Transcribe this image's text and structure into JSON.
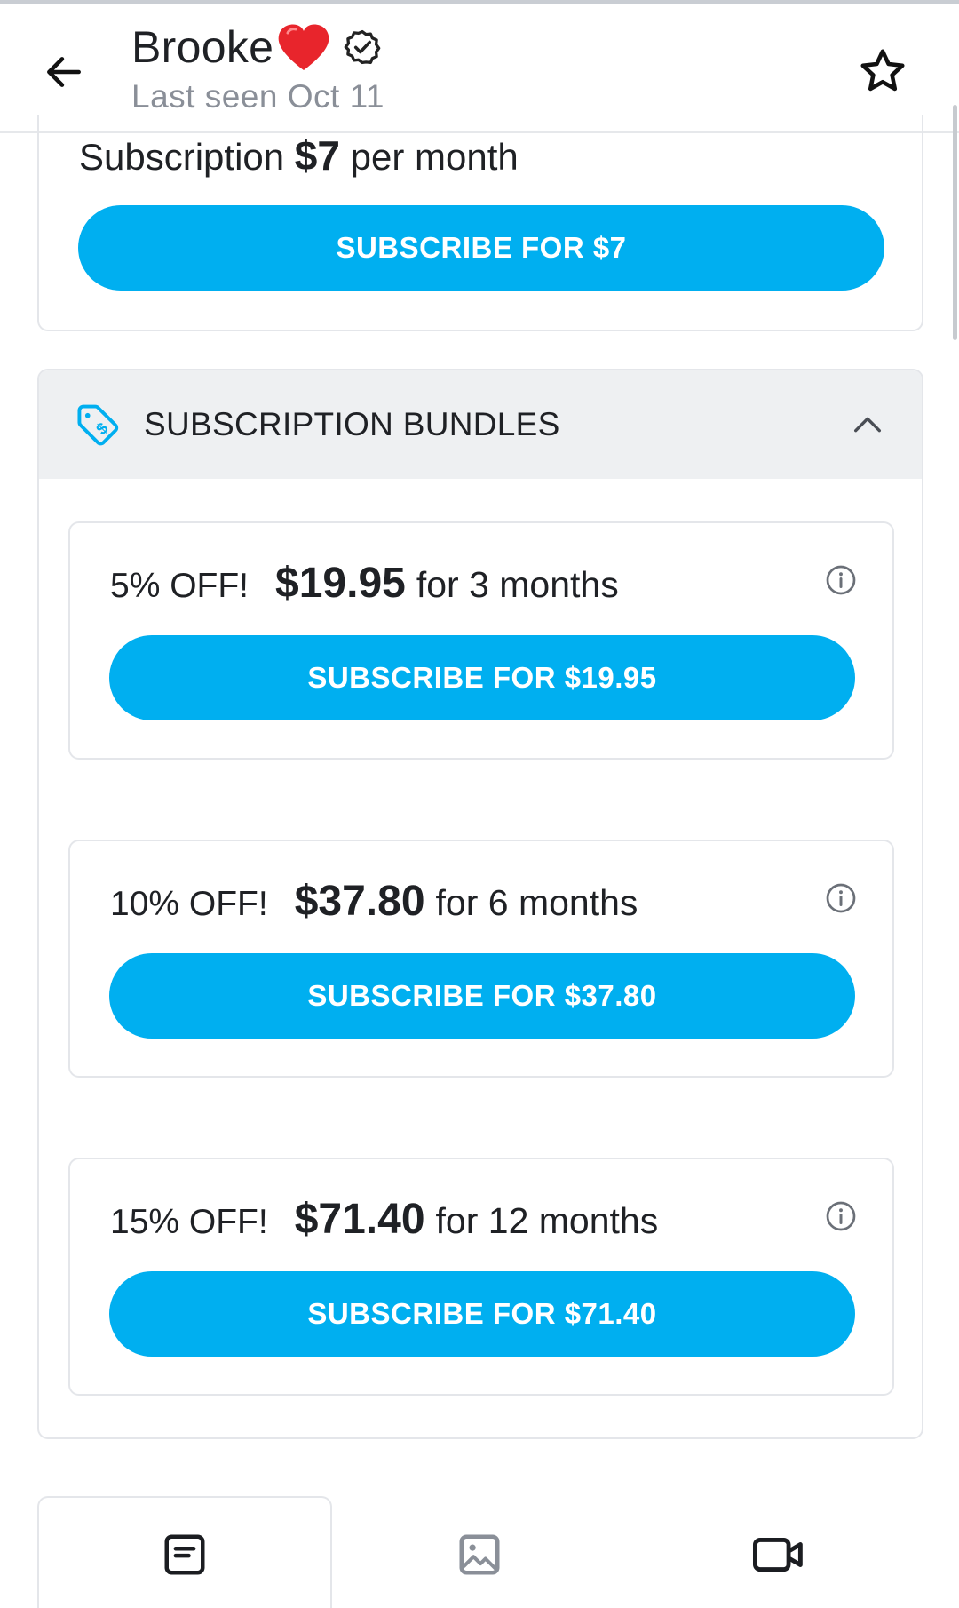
{
  "header": {
    "name": "Brooke",
    "last_seen": "Last seen Oct 11"
  },
  "subscription": {
    "label_prefix": "Subscription",
    "price": "$7",
    "label_suffix": "per month",
    "button_label": "SUBSCRIBE FOR $7"
  },
  "bundles": {
    "title": "SUBSCRIPTION BUNDLES",
    "items": [
      {
        "off": "5% OFF!",
        "amount": "$19.95",
        "duration": "for 3 months",
        "button_label": "SUBSCRIBE FOR $19.95"
      },
      {
        "off": "10% OFF!",
        "amount": "$37.80",
        "duration": "for 6 months",
        "button_label": "SUBSCRIBE FOR $37.80"
      },
      {
        "off": "15% OFF!",
        "amount": "$71.40",
        "duration": "for 12 months",
        "button_label": "SUBSCRIBE FOR $71.40"
      }
    ]
  },
  "tabs": {
    "items": [
      {
        "icon": "posts-icon",
        "active": true
      },
      {
        "icon": "photos-icon",
        "active": false
      },
      {
        "icon": "videos-icon",
        "active": false
      }
    ]
  },
  "colors": {
    "accent": "#00aff0",
    "heart": "#e8252c",
    "muted_text": "#8a8f98",
    "section_header_bg": "#eef0f2"
  },
  "icons": {
    "back": "arrow-left-icon",
    "emoji": "red-heart-icon",
    "verified": "verified-badge-icon",
    "favorite": "star-icon",
    "bundles": "price-tag-icon",
    "collapse": "chevron-up-icon",
    "info": "info-icon"
  }
}
